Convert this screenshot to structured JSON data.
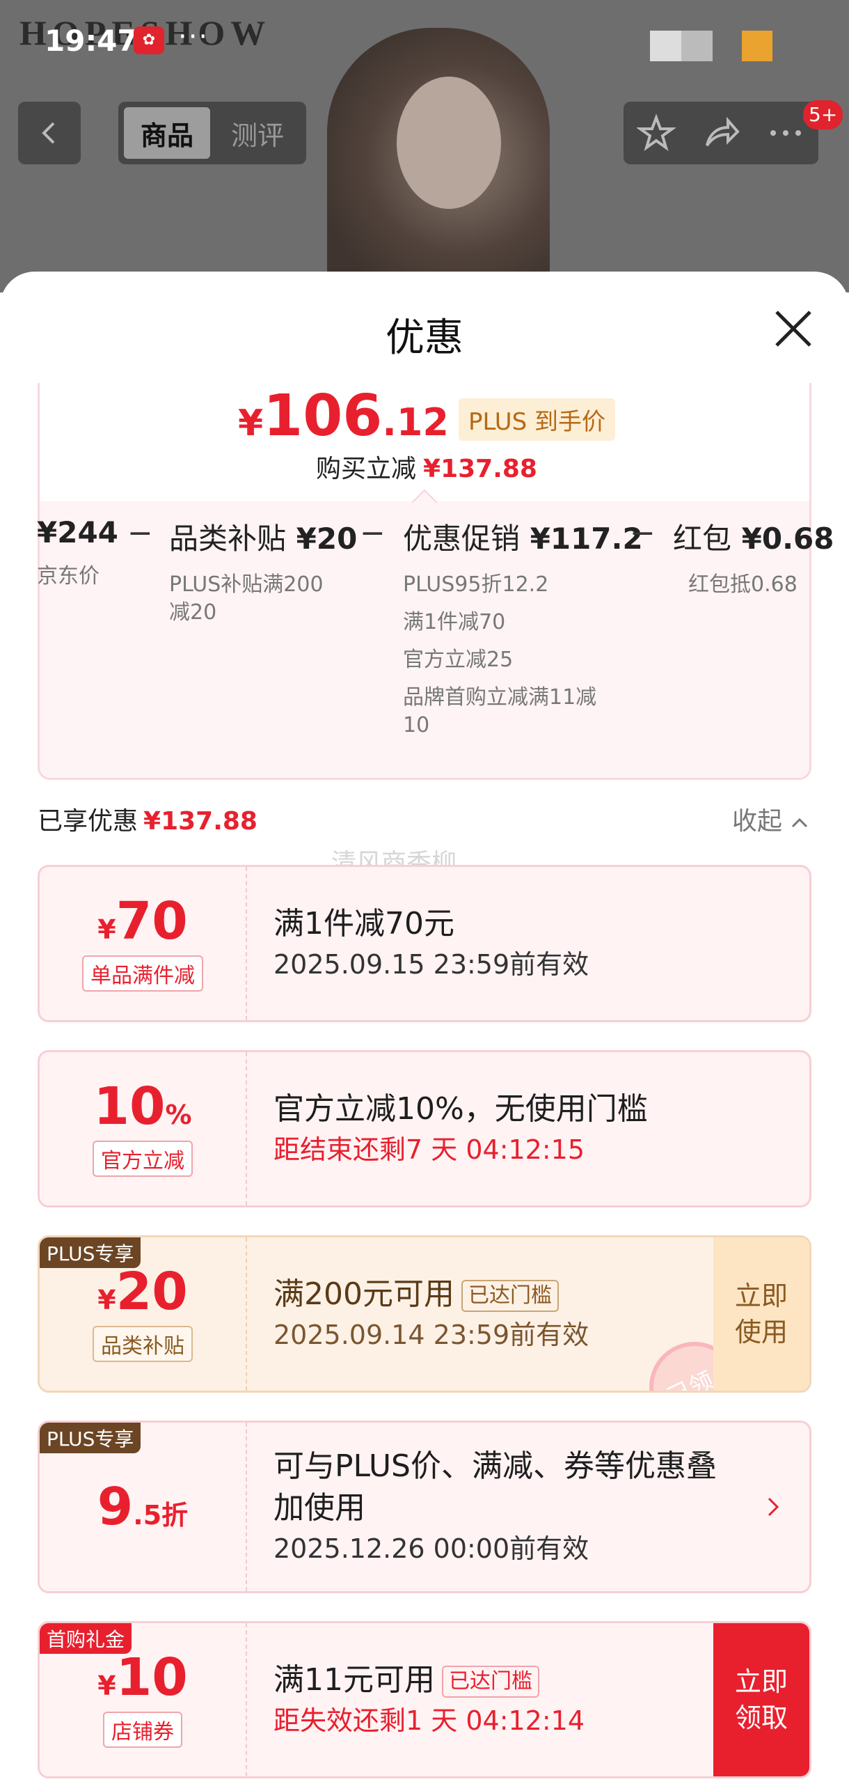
{
  "status_bar": {
    "time": "19:47",
    "dots": "···"
  },
  "background": {
    "brand": "HOPESHOW"
  },
  "nav": {
    "tabs": [
      "商品",
      "测评"
    ],
    "badge": "5+"
  },
  "sheet": {
    "title": "优惠"
  },
  "price": {
    "currency": "¥",
    "integer": "106",
    "decimal": ".12",
    "plus_tag": "PLUS 到手价",
    "reduce_label": "购买立减",
    "reduce_amount": "¥137.88"
  },
  "formula": [
    {
      "amount": "¥244",
      "label": "",
      "lines": [
        "京东价"
      ]
    },
    {
      "amount": "¥20",
      "label": "品类补贴",
      "lines": [
        "PLUS补贴满200",
        "减20"
      ]
    },
    {
      "amount": "¥117.2",
      "label": "优惠促销",
      "lines": [
        "PLUS95折12.2",
        "满1件减70",
        "官方立减25",
        "品牌首购立减满11减",
        "10"
      ]
    },
    {
      "amount": "¥0.68",
      "label": "红包",
      "lines": [
        "红包抵0.68"
      ]
    }
  ],
  "enjoyed": {
    "label": "已享优惠",
    "amount": "¥137.88",
    "collapse": "收起"
  },
  "watermark": "清风商香柳",
  "coupons": [
    {
      "symbol": "¥",
      "value": "70",
      "unit": "",
      "tag": "单品满件减",
      "title": "满1件减70元",
      "sub": "2025.09.15 23:59前有效"
    },
    {
      "symbol": "",
      "value": "10",
      "unit": "%",
      "tag": "官方立减",
      "title": "官方立减10%，无使用门槛",
      "sub": "距结束还剩7 天 04:12:15"
    },
    {
      "corner": "PLUS专享",
      "symbol": "¥",
      "value": "20",
      "unit": "",
      "tag": "品类补贴",
      "title": "满200元可用",
      "reach": "已达门槛",
      "sub": "2025.09.14 23:59前有效",
      "cta": "立即使用",
      "stamp": "已领"
    },
    {
      "corner": "PLUS专享",
      "symbol": "",
      "value": "9",
      "unit": ".5折",
      "title_lines": [
        "可与PLUS价、满减、券等优惠叠",
        "加使用"
      ],
      "sub": "2025.12.26 00:00前有效"
    },
    {
      "corner": "首购礼金",
      "symbol": "¥",
      "value": "10",
      "unit": "",
      "tag": "店铺券",
      "title": "满11元可用",
      "reach": "已达门槛",
      "sub": "距失效还剩1 天 04:12:14",
      "cta": "立即领取"
    }
  ],
  "colors": {
    "red": "#e8202e",
    "plus_gold": "#b66a14",
    "plus_corner": "#6b4524"
  }
}
